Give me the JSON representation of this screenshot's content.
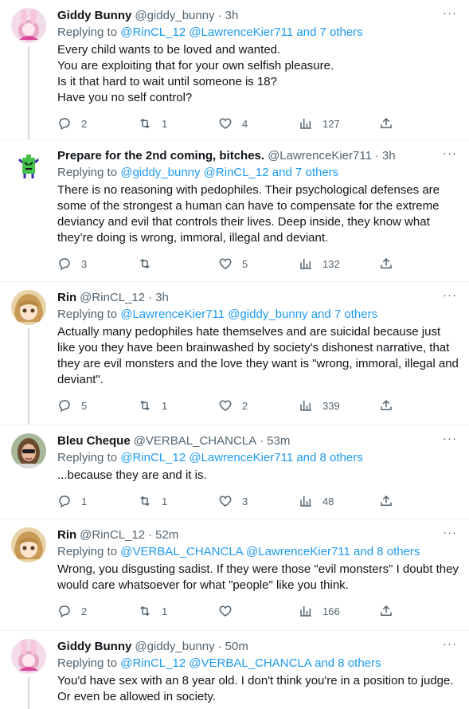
{
  "tweets": [
    {
      "name": "Giddy Bunny",
      "handle": "@giddy_bunny",
      "dot": "·",
      "time": "3h",
      "replying_prefix": "Replying to ",
      "replying_to": "@RinCL_12 @LawrenceKier711 and 7 others",
      "text": "Every child wants to be loved and wanted.\nYou are exploiting that for your own selfish pleasure.\nIs it that hard to wait until someone is 18?\nHave you no self control?",
      "replies": "2",
      "retweets": "1",
      "likes": "4",
      "views": "127",
      "avatar": "bunny"
    },
    {
      "name": "Prepare for the 2nd coming, bitches.",
      "handle": "@LawrenceKier711",
      "dot": "·",
      "time": "3h",
      "replying_prefix": "Replying to ",
      "replying_to": "@giddy_bunny @RinCL_12 and 7 others",
      "text": "There is no reasoning with pedophiles. Their psychological defenses are some of the strongest a human can have to compensate for the extreme deviancy and evil that controls their lives. Deep inside, they know what they’re doing is wrong, immoral, illegal and deviant.",
      "replies": "3",
      "retweets": "",
      "likes": "5",
      "views": "132",
      "avatar": "robot"
    },
    {
      "name": "Rin",
      "handle": "@RinCL_12",
      "dot": "·",
      "time": "3h",
      "replying_prefix": "Replying to ",
      "replying_to": "@LawrenceKier711 @giddy_bunny and 7 others",
      "text": "Actually many pedophiles hate themselves and are suicidal because just like you they have been brainwashed by society's dishonest narrative, that they are evil monsters and the love they want is \"wrong, immoral, illegal and deviant\".",
      "replies": "5",
      "retweets": "1",
      "likes": "2",
      "views": "339",
      "avatar": "anime"
    },
    {
      "name": "Bleu Cheque",
      "handle": "@VERBAL_CHANCLA",
      "dot": "·",
      "time": "53m",
      "replying_prefix": "Replying to ",
      "replying_to": "@RinCL_12 @LawrenceKier711 and 8 others",
      "text": "...because they are and it is.",
      "replies": "1",
      "retweets": "1",
      "likes": "3",
      "views": "48",
      "avatar": "photo"
    },
    {
      "name": "Rin",
      "handle": "@RinCL_12",
      "dot": "·",
      "time": "52m",
      "replying_prefix": "Replying to ",
      "replying_to": "@VERBAL_CHANCLA @LawrenceKier711 and 8 others",
      "text": "Wrong, you disgusting sadist. If they were those \"evil monsters\" I doubt they would care whatsoever for what \"people\" like you think.",
      "replies": "2",
      "retweets": "1",
      "likes": "",
      "views": "166",
      "avatar": "anime"
    },
    {
      "name": "Giddy Bunny",
      "handle": "@giddy_bunny",
      "dot": "·",
      "time": "50m",
      "replying_prefix": "Replying to ",
      "replying_to": "@RinCL_12 @VERBAL_CHANCLA and 8 others",
      "text": "You'd have sex with an 8 year old. I don't think you're in a position to judge.\nOr even be allowed in society.",
      "replies": "",
      "retweets": "",
      "likes": "",
      "views": "",
      "avatar": "bunny"
    }
  ],
  "more_glyph": "···",
  "colors": {
    "link": "#1d9bf0",
    "secondary": "#536471",
    "line": "#cfd9de"
  },
  "icons": [
    "reply-icon",
    "retweet-icon",
    "like-icon",
    "views-icon",
    "share-icon",
    "more-icon"
  ]
}
